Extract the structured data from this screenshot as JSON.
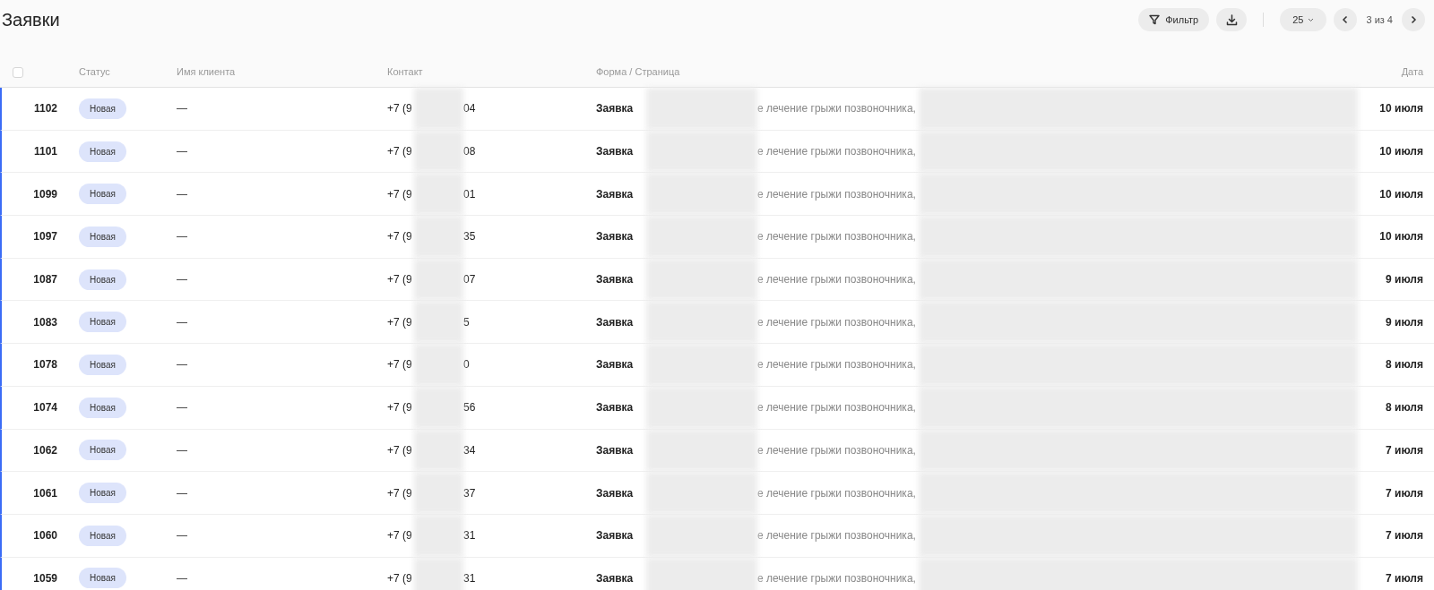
{
  "title": "Заявки",
  "toolbar": {
    "filter_button": "Фильтр",
    "page_size": "25",
    "pagination": "3 из 4"
  },
  "table": {
    "select_all": {
      "checked": false
    },
    "columns": [
      "Статус",
      "Имя клиента",
      "Контакт",
      "Форма / Страница",
      "Дата"
    ],
    "rows": [
      {
        "id": "1102",
        "status": "Новая",
        "client": "—",
        "contact_start": "+7 (9",
        "contact_end": "04",
        "form": "Заявка",
        "page": "е лечение грыжи позвоночника,",
        "date": "10 июля"
      },
      {
        "id": "1101",
        "status": "Новая",
        "client": "—",
        "contact_start": "+7 (9",
        "contact_end": "08",
        "form": "Заявка",
        "page": "е лечение грыжи позвоночника,",
        "date": "10 июля"
      },
      {
        "id": "1099",
        "status": "Новая",
        "client": "—",
        "contact_start": "+7 (9",
        "contact_end": "01",
        "form": "Заявка",
        "page": "е лечение грыжи позвоночника,",
        "date": "10 июля"
      },
      {
        "id": "1097",
        "status": "Новая",
        "client": "—",
        "contact_start": "+7 (9",
        "contact_end": "35",
        "form": "Заявка",
        "page": "е лечение грыжи позвоночника,",
        "date": "10 июля"
      },
      {
        "id": "1087",
        "status": "Новая",
        "client": "—",
        "contact_start": "+7 (9",
        "contact_end": "07",
        "form": "Заявка",
        "page": "е лечение грыжи позвоночника,",
        "date": "9 июля"
      },
      {
        "id": "1083",
        "status": "Новая",
        "client": "—",
        "contact_start": "+7 (9",
        "contact_end": "5",
        "form": "Заявка",
        "page": "е лечение грыжи позвоночника,",
        "date": "9 июля"
      },
      {
        "id": "1078",
        "status": "Новая",
        "client": "—",
        "contact_start": "+7 (9",
        "contact_end": "0",
        "form": "Заявка",
        "page": "е лечение грыжи позвоночника,",
        "date": "8 июля"
      },
      {
        "id": "1074",
        "status": "Новая",
        "client": "—",
        "contact_start": "+7 (9",
        "contact_end": "56",
        "form": "Заявка",
        "page": "е лечение грыжи позвоночника,",
        "date": "8 июля"
      },
      {
        "id": "1062",
        "status": "Новая",
        "client": "—",
        "contact_start": "+7 (9",
        "contact_end": "34",
        "form": "Заявка",
        "page": "е лечение грыжи позвоночника,",
        "date": "7 июля"
      },
      {
        "id": "1061",
        "status": "Новая",
        "client": "—",
        "contact_start": "+7 (9",
        "contact_end": "37",
        "form": "Заявка",
        "page": "е лечение грыжи позвоночника,",
        "date": "7 июля"
      },
      {
        "id": "1060",
        "status": "Новая",
        "client": "—",
        "contact_start": "+7 (9",
        "contact_end": "31",
        "form": "Заявка",
        "page": "е лечение грыжи позвоночника,",
        "date": "7 июля"
      },
      {
        "id": "1059",
        "status": "Новая",
        "client": "—",
        "contact_start": "+7 (9",
        "contact_end": "31",
        "form": "Заявка",
        "page": "е лечение грыжи позвоночника,",
        "date": "7 июля"
      }
    ]
  }
}
